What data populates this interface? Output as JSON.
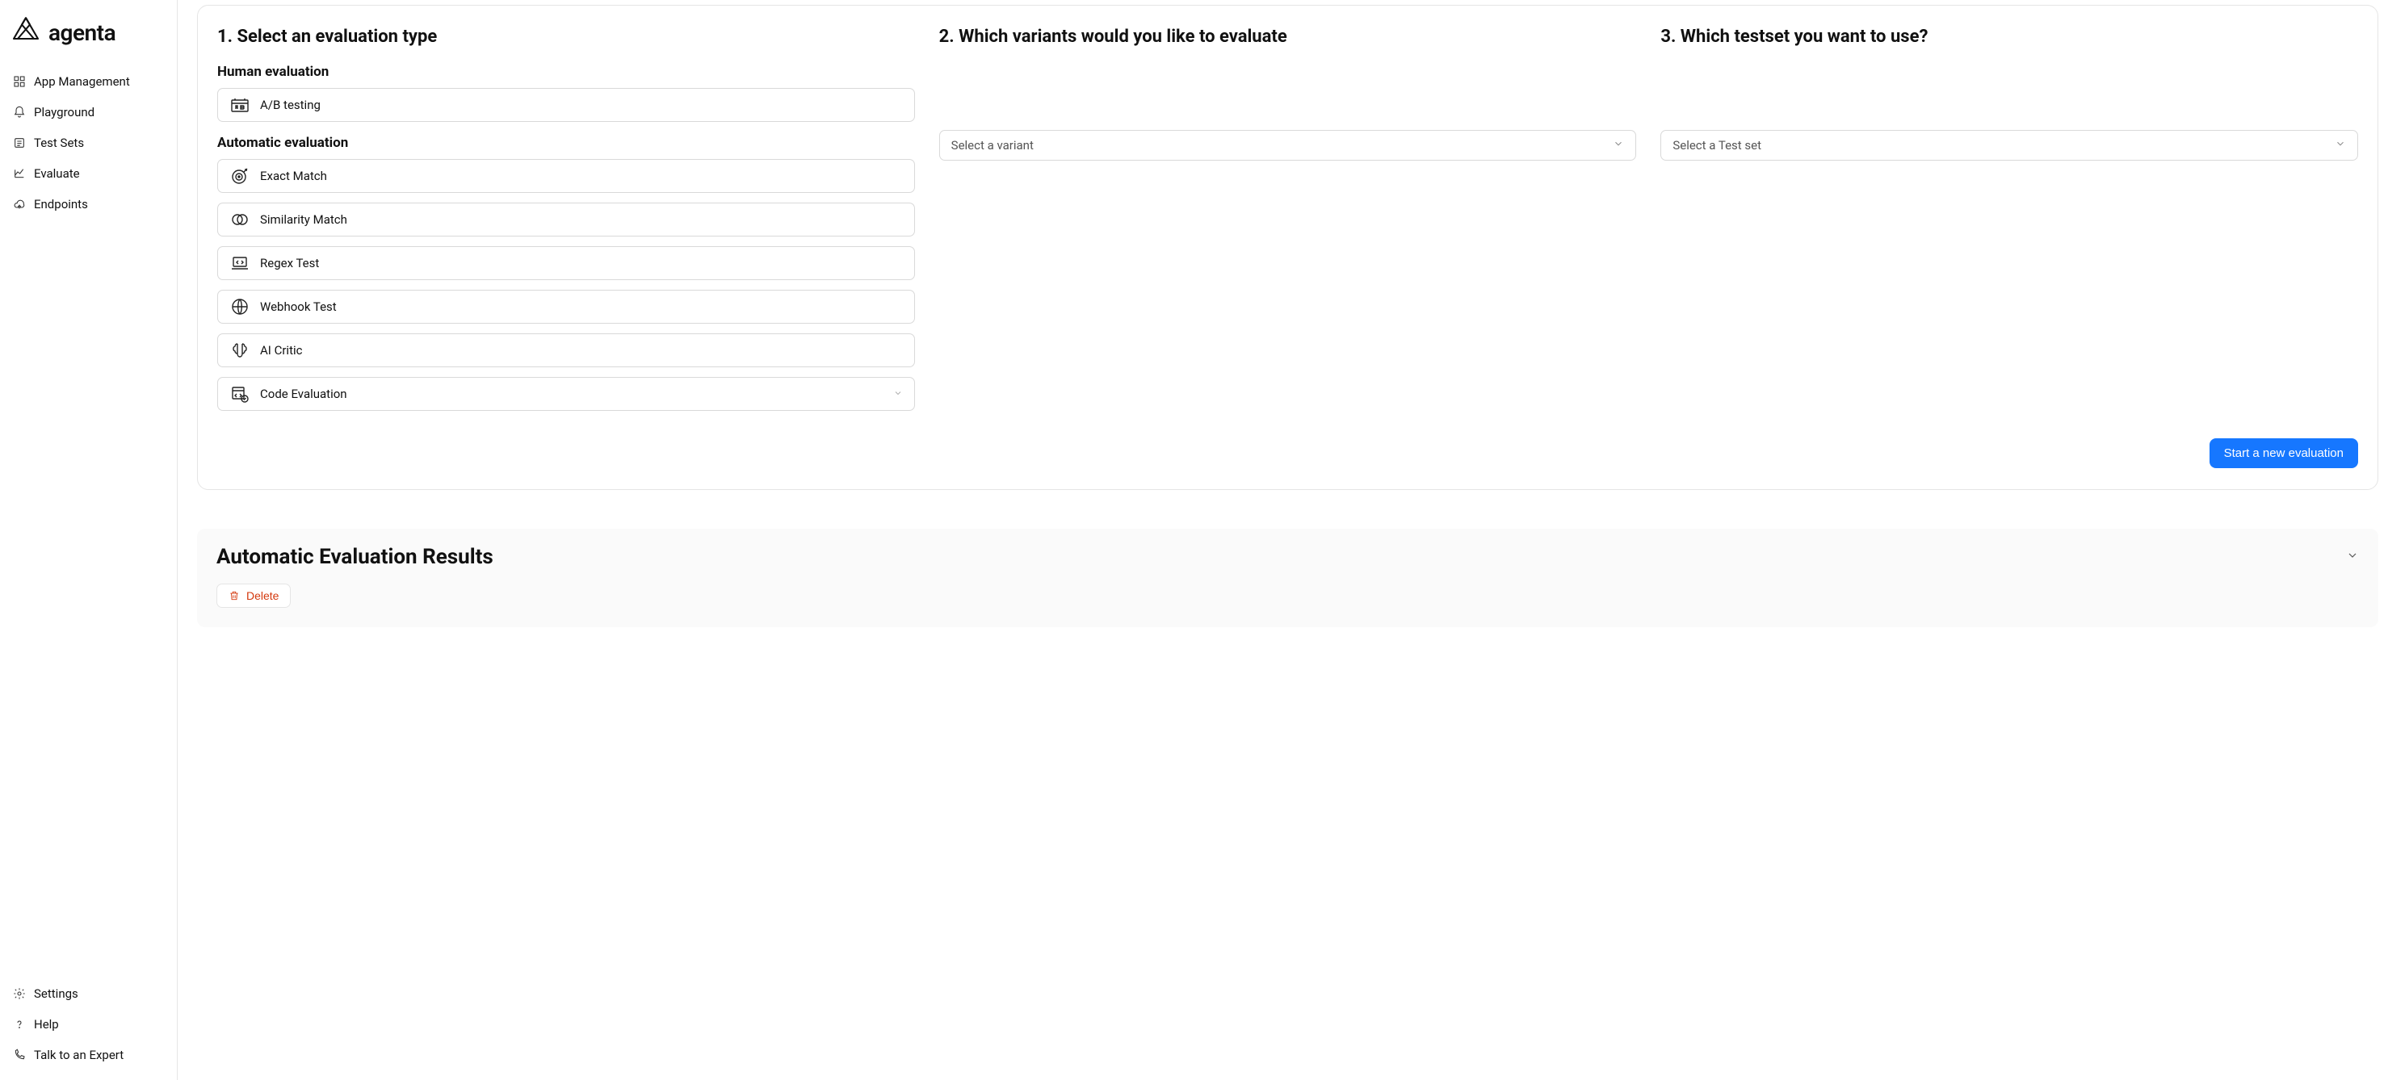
{
  "brand": {
    "name": "agenta"
  },
  "sidebar": {
    "top": [
      {
        "key": "app-management",
        "label": "App Management"
      },
      {
        "key": "playground",
        "label": "Playground"
      },
      {
        "key": "test-sets",
        "label": "Test Sets"
      },
      {
        "key": "evaluate",
        "label": "Evaluate"
      },
      {
        "key": "endpoints",
        "label": "Endpoints"
      }
    ],
    "bottom": [
      {
        "key": "settings",
        "label": "Settings"
      },
      {
        "key": "help",
        "label": "Help"
      },
      {
        "key": "talk",
        "label": "Talk to an Expert"
      }
    ]
  },
  "steps": {
    "step1": {
      "title": "1. Select an evaluation type"
    },
    "step2": {
      "title": "2. Which variants would you like to evaluate"
    },
    "step3": {
      "title": "3. Which testset you want to use?"
    }
  },
  "human_eval": {
    "heading": "Human evaluation",
    "options": [
      {
        "key": "ab",
        "label": "A/B testing"
      }
    ]
  },
  "auto_eval": {
    "heading": "Automatic evaluation",
    "options": [
      {
        "key": "exact",
        "label": "Exact Match"
      },
      {
        "key": "similarity",
        "label": "Similarity Match"
      },
      {
        "key": "regex",
        "label": "Regex Test"
      },
      {
        "key": "webhook",
        "label": "Webhook Test"
      },
      {
        "key": "ai",
        "label": "AI Critic"
      },
      {
        "key": "code",
        "label": "Code Evaluation",
        "has_dropdown": true
      }
    ]
  },
  "variant_select": {
    "placeholder": "Select a variant"
  },
  "testset_select": {
    "placeholder": "Select a Test set"
  },
  "start_button": {
    "label": "Start a new evaluation"
  },
  "results_section": {
    "title": "Automatic Evaluation Results"
  },
  "delete_button": {
    "label": "Delete"
  },
  "colors": {
    "primary": "#1677ff",
    "danger": "#d4380d"
  }
}
